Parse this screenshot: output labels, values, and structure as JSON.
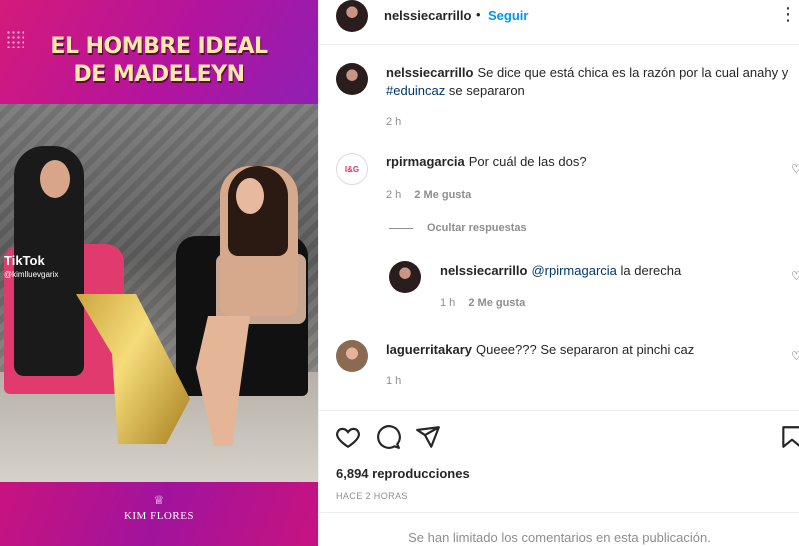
{
  "media": {
    "headline_line1": "EL HOMBRE IDEAL",
    "headline_line2": "DE MADELEYN",
    "tiktok_label": "TikTok",
    "tiktok_handle": "@kimlluevgarix",
    "brand": "KIM FLORES"
  },
  "header": {
    "username": "nelssiecarrillo",
    "separator": "•",
    "follow_label": "Seguir",
    "more_icon": "more-horizontal-icon"
  },
  "caption": {
    "username": "nelssiecarrillo",
    "text": "Se dice que está chica es la razón por la cual anahy y ",
    "hashtag": "#eduincaz",
    "text_after": " se separaron",
    "age": "2 h"
  },
  "comments": [
    {
      "username": "rpirmagarcia",
      "text": "Por cuál de las dos?",
      "age": "2 h",
      "likes": "2 Me gusta",
      "avatar_text": "I&G"
    },
    {
      "username": "laguerritakary",
      "text": "Queee??? Se separaron at pinchi caz",
      "age": "1 h"
    }
  ],
  "replies_toggle": "Ocultar respuestas",
  "reply": {
    "username": "nelssiecarrillo",
    "mention": "@rpirmagarcia",
    "text": " la derecha",
    "age": "1 h",
    "likes": "2 Me gusta"
  },
  "actions": {
    "like_icon": "heart-icon",
    "comment_icon": "comment-icon",
    "share_icon": "send-icon",
    "save_icon": "bookmark-icon"
  },
  "stats": {
    "views": "6,894 reproducciones",
    "posted": "HACE 2 HORAS"
  },
  "footer": {
    "limited_comments": "Se han limitado los comentarios en esta publicación."
  },
  "colors": {
    "link_blue": "#0095f6",
    "meta_gray": "#8e8e8e",
    "media_magenta": "#c8157e"
  }
}
